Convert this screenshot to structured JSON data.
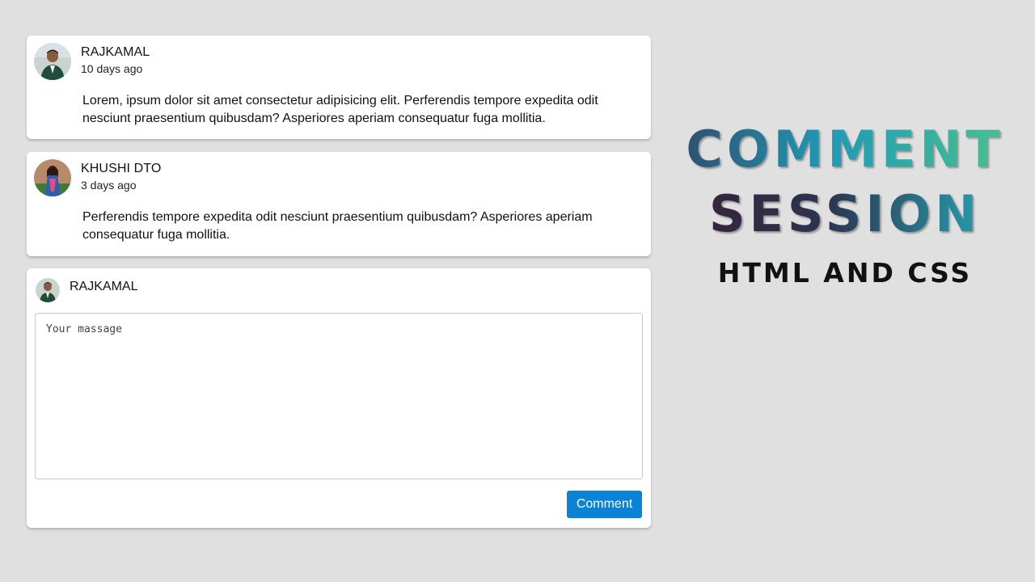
{
  "comments": [
    {
      "author": "RAJKAMAL",
      "time": "10 days ago",
      "text": "Lorem, ipsum dolor sit amet consectetur adipisicing elit. Perferendis tempore expedita odit nesciunt praesentium quibusdam? Asperiores aperiam consequatur fuga mollitia.",
      "avatar": "avatar-man-photo"
    },
    {
      "author": "KHUSHI DTO",
      "time": "3 days ago",
      "text": "Perferendis tempore expedita odit nesciunt praesentium quibusdam? Asperiores aperiam consequatur fuga mollitia.",
      "avatar": "avatar-woman-photo"
    }
  ],
  "composer": {
    "author": "RAJKAMAL",
    "placeholder": "Your massage",
    "value": "",
    "button_label": "Comment"
  },
  "hero": {
    "line1": "COMMENT",
    "line2": "SESSION",
    "line3": "HTML AND CSS"
  },
  "colors": {
    "background": "#e0e0e0",
    "card": "#ffffff",
    "button": "#0a83d6"
  }
}
